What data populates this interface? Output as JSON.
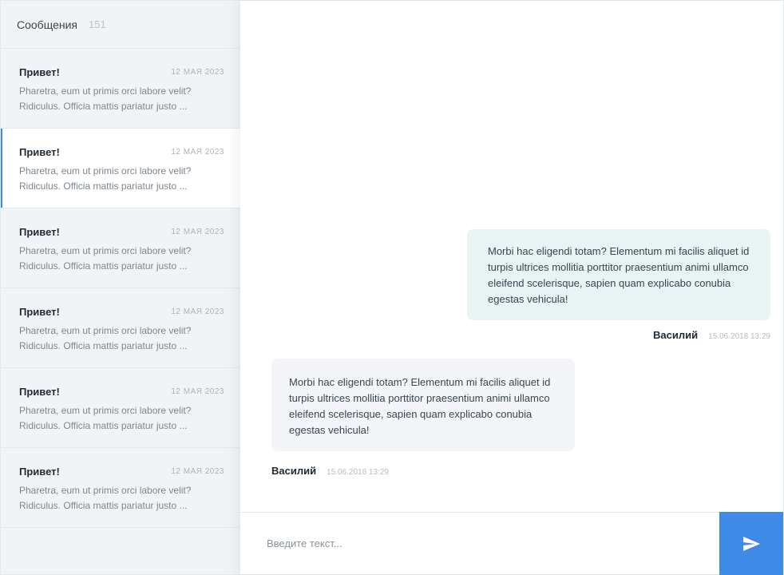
{
  "sidebar": {
    "title": "Сообщения",
    "count": "151",
    "conversations": [
      {
        "title": "Привет!",
        "date": "12 МАЯ 2023",
        "preview": "Pharetra, eum ut primis orci labore velit? Ridiculus. Officia mattis pariatur justo ...",
        "active": false
      },
      {
        "title": "Привет!",
        "date": "12 МАЯ 2023",
        "preview": "Pharetra, eum ut primis orci labore velit? Ridiculus. Officia mattis pariatur justo ...",
        "active": true
      },
      {
        "title": "Привет!",
        "date": "12 МАЯ 2023",
        "preview": "Pharetra, eum ut primis orci labore velit? Ridiculus. Officia mattis pariatur justo ...",
        "active": false
      },
      {
        "title": "Привет!",
        "date": "12 МАЯ 2023",
        "preview": "Pharetra, eum ut primis orci labore velit? Ridiculus. Officia mattis pariatur justo ...",
        "active": false
      },
      {
        "title": "Привет!",
        "date": "12 МАЯ 2023",
        "preview": "Pharetra, eum ut primis orci labore velit? Ridiculus. Officia mattis pariatur justo ...",
        "active": false
      },
      {
        "title": "Привет!",
        "date": "12 МАЯ 2023",
        "preview": "Pharetra, eum ut primis orci labore velit? Ridiculus. Officia mattis pariatur justo ...",
        "active": false
      }
    ]
  },
  "chat": {
    "messages": [
      {
        "direction": "outgoing",
        "text": "Morbi hac eligendi totam? Elementum mi facilis aliquet id turpis ultrices mollitia porttitor praesentium animi ullamco eleifend scelerisque, sapien quam explicabo conubia egestas vehicula!",
        "author": "Василий",
        "time": "15.06.2018 13:29"
      },
      {
        "direction": "incoming",
        "text": "Morbi hac eligendi totam? Elementum mi facilis aliquet id turpis ultrices mollitia porttitor praesentium animi ullamco eleifend scelerisque, sapien quam explicabo conubia egestas vehicula!",
        "author": "Василий",
        "time": "15.06.2018 13:29"
      }
    ]
  },
  "composer": {
    "placeholder": "Введите текст...",
    "value": "",
    "send_icon": "send-icon"
  },
  "colors": {
    "accent": "#3f8ae6",
    "sidebar_bg": "#f1f4f7",
    "outgoing_bubble": "#e8f3f3",
    "incoming_bubble": "#f3f5f8"
  }
}
